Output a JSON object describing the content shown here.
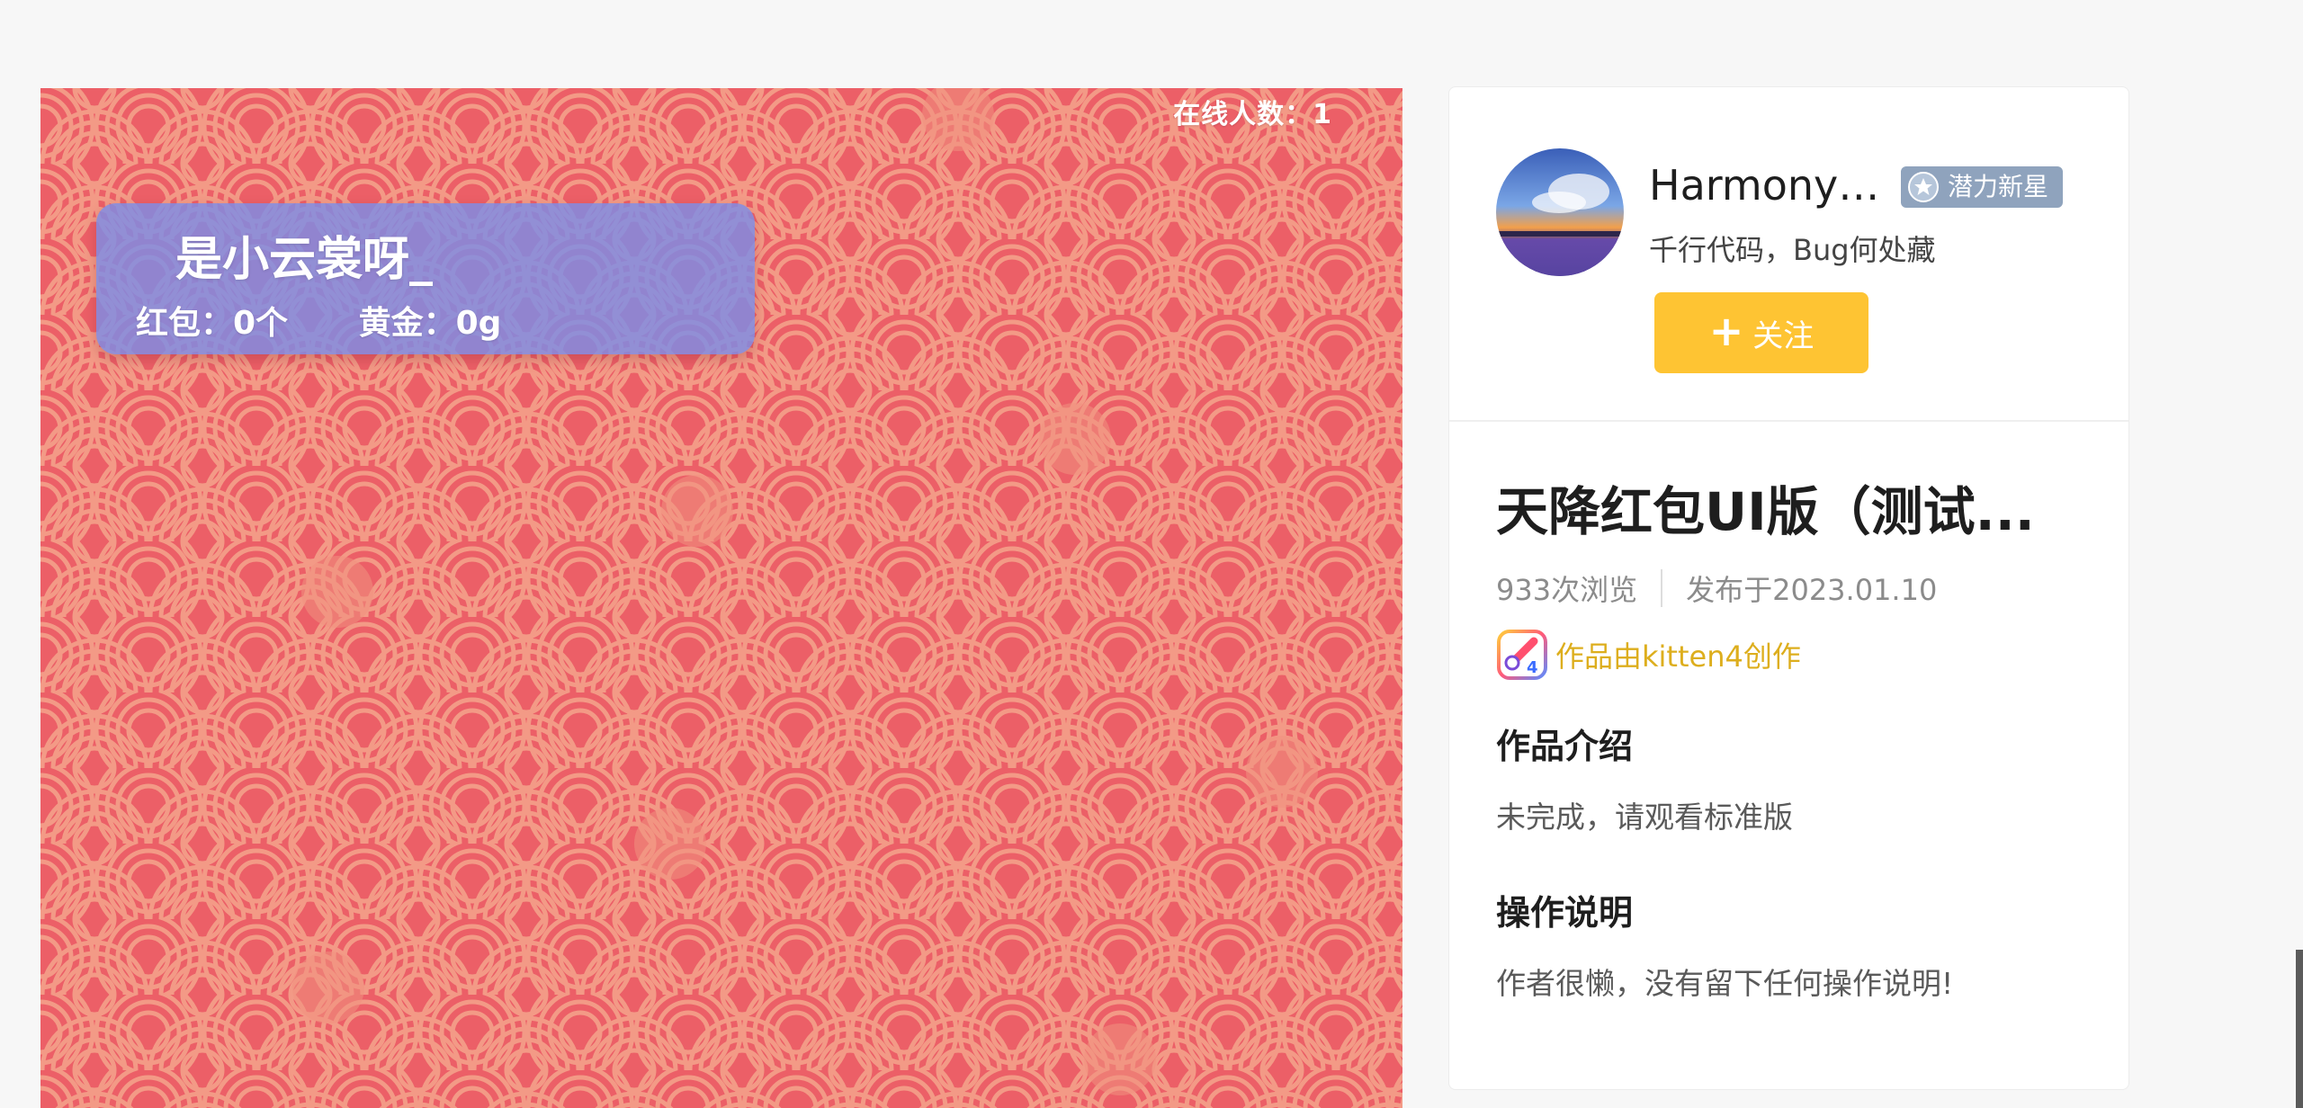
{
  "game": {
    "online_label": "在线人数：1",
    "player_name": "是小云裳呀_",
    "red_packet_stat": "红包：0个",
    "gold_stat": "黄金：0g",
    "colors": {
      "background": "#ec5f67",
      "wave_stroke": "#f39a86",
      "player_card": "#7d8ce6"
    }
  },
  "author": {
    "name": "HarmonyO...",
    "badge": "潜力新星",
    "motto": "千行代码，Bug何处藏",
    "follow_label": "关注",
    "follow_icon": "plus-icon"
  },
  "work": {
    "title": "天降红包UI版（测试...",
    "views": "933次浏览",
    "published": "发布于2023.01.10",
    "made_by": "作品由kitten4创作",
    "intro_heading": "作品介绍",
    "intro_text": "未完成，请观看标准版",
    "instructions_heading": "操作说明",
    "instructions_text": "作者很懒，没有留下任何操作说明!"
  },
  "colors": {
    "accent_yellow": "#fec433",
    "made_by_text": "#ddae1d",
    "badge_bg": "#8fa3bd"
  }
}
